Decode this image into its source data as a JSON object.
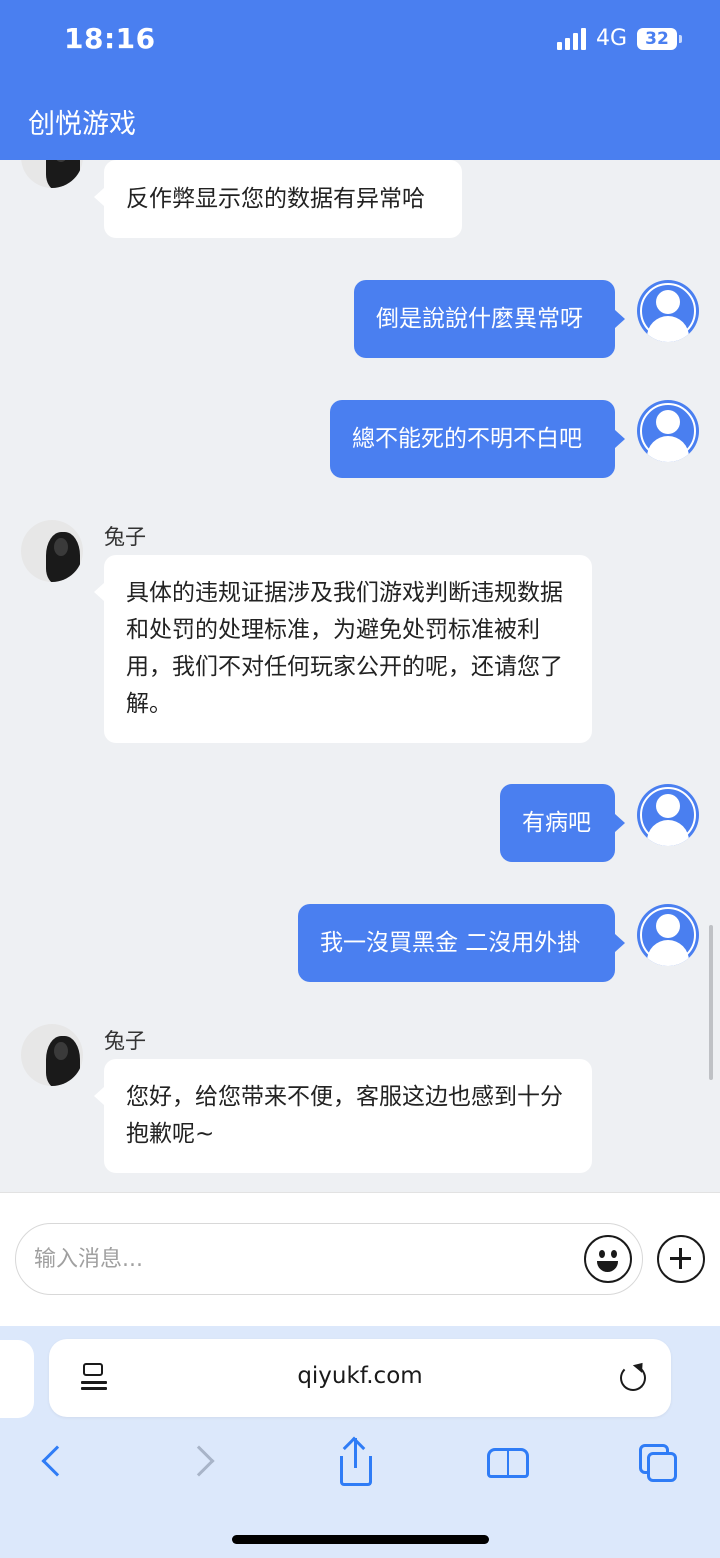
{
  "status_bar": {
    "time": "18:16",
    "network": "4G",
    "battery": "32"
  },
  "header": {
    "title": "创悦游戏"
  },
  "messages": [
    {
      "role": "agent",
      "sender": "",
      "text": "反作弊显示您的数据有异常哈"
    },
    {
      "role": "user",
      "text": "倒是說說什麼異常呀"
    },
    {
      "role": "user",
      "text": "總不能死的不明不白吧"
    },
    {
      "role": "agent",
      "sender": "兔子",
      "text": "具体的违规证据涉及我们游戏判断违规数据和处罚的处理标准，为避免处罚标准被利用，我们不对任何玩家公开的呢，还请您了解。"
    },
    {
      "role": "user",
      "text": "有病吧"
    },
    {
      "role": "user",
      "text": "我一沒買黑金 二沒用外掛"
    },
    {
      "role": "agent",
      "sender": "兔子",
      "text": "您好，给您带来不便，客服这边也感到十分抱歉呢~"
    }
  ],
  "composer": {
    "placeholder": "输入消息..."
  },
  "browser": {
    "url": "qiyukf.com"
  },
  "colors": {
    "brand": "#4a7ff0",
    "user_bubble": "#4a7ff0",
    "agent_bubble": "#ffffff",
    "chat_bg": "#eef0f3",
    "safari_accent": "#2f7cf6"
  }
}
